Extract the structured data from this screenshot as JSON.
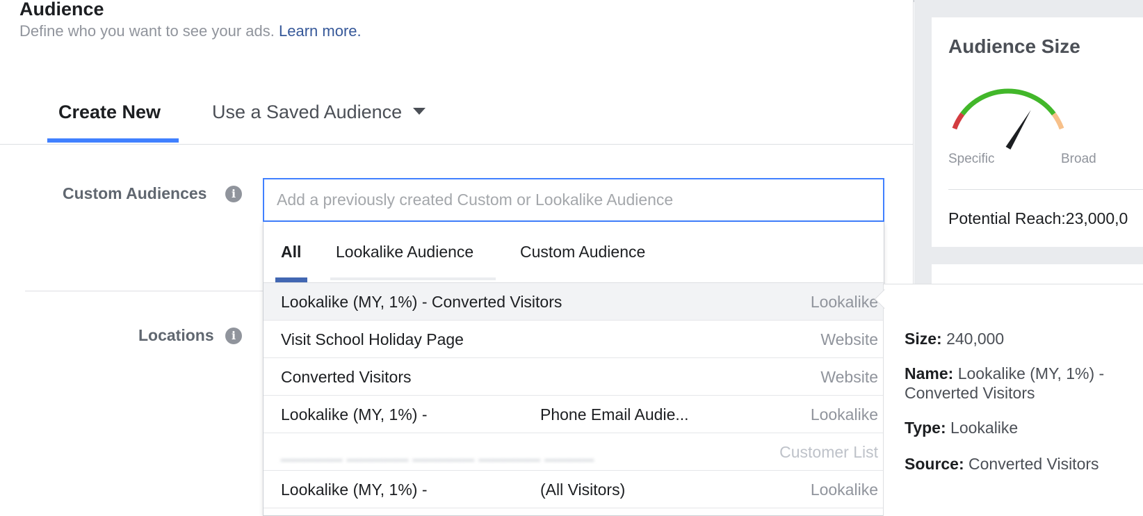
{
  "section": {
    "title": "Audience",
    "subtitle": "Define who you want to see your ads.",
    "learn_more": "Learn more."
  },
  "tabs": {
    "create_new": "Create New",
    "use_saved": "Use a Saved Audience"
  },
  "fields": {
    "custom_audiences_label": "Custom Audiences",
    "locations_label": "Locations"
  },
  "search": {
    "placeholder": "Add a previously created Custom or Lookalike Audience",
    "value": ""
  },
  "dropdown": {
    "tabs": {
      "all": "All",
      "lookalike": "Lookalike Audience",
      "custom": "Custom Audience"
    },
    "items": [
      {
        "name": "Lookalike (MY, 1%) - Converted Visitors",
        "type": "Lookalike"
      },
      {
        "name": "Visit School Holiday Page",
        "type": "Website"
      },
      {
        "name": "Converted Visitors",
        "type": "Website"
      },
      {
        "name": "Lookalike (MY, 1%) -",
        "name_tail": "Phone Email Audie...",
        "type": "Lookalike"
      },
      {
        "name": "",
        "type": "Customer List"
      },
      {
        "name": "Lookalike (MY, 1%) -",
        "name_tail": "(All Visitors)",
        "type": "Lookalike"
      }
    ]
  },
  "details": {
    "size_label": "Size:",
    "size_value": "240,000",
    "name_label": "Name:",
    "name_value": "Lookalike (MY, 1%) - Converted Visitors",
    "type_label": "Type:",
    "type_value": "Lookalike",
    "source_label": "Source:",
    "source_value": "Converted Visitors"
  },
  "audience_size": {
    "title": "Audience Size",
    "specific_label": "Specific",
    "broad_label": "Broad",
    "potential_reach": "Potential Reach:23,000,0",
    "gauge_level": 0.72,
    "colors": {
      "low": "#d33c40",
      "mid": "#42b72a",
      "high": "#f7c08a",
      "needle": "#1c1e21"
    }
  },
  "colors": {
    "accent": "#4080ff",
    "link": "#365899",
    "tab_indicator": "#4267b2"
  }
}
